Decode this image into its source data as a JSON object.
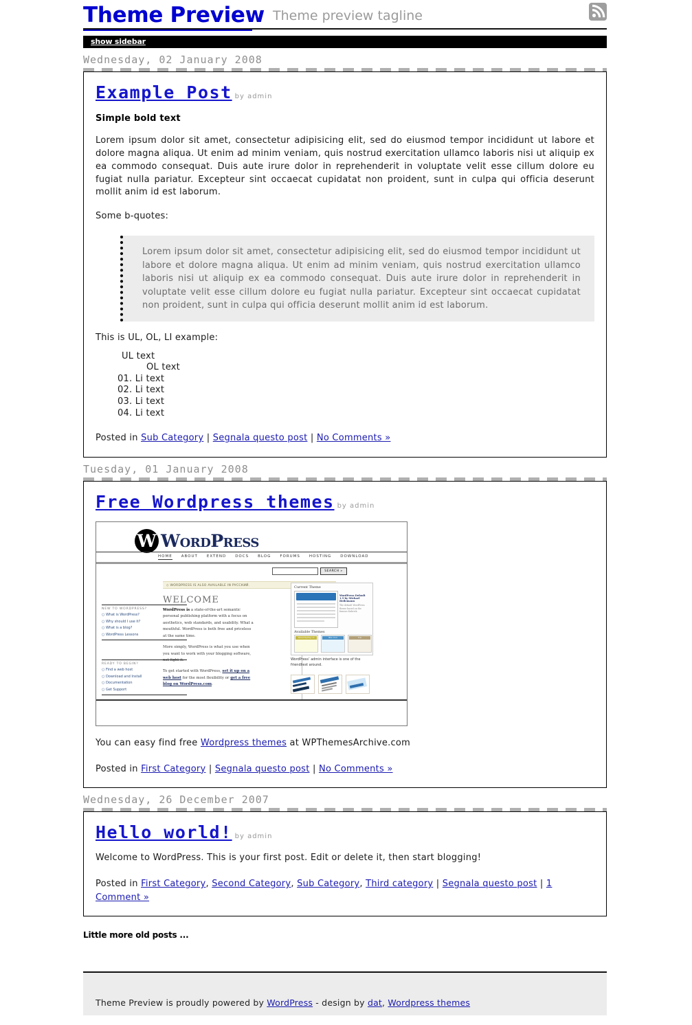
{
  "header": {
    "blog_title": "Theme Preview",
    "tagline": "Theme preview tagline",
    "rss_icon": "rss-feed-icon",
    "sidebar_toggle": "show sidebar"
  },
  "posts": [
    {
      "date": "Wednesday, 02 January 2008",
      "title": "Example Post",
      "byline": "by admin",
      "subhead": "Simple bold text",
      "body": "Lorem ipsum dolor sit amet, consectetur adipisicing elit, sed do eiusmod tempor incididunt ut labore et dolore magna aliqua. Ut enim ad minim veniam, quis nostrud exercitation ullamco laboris nisi ut aliquip ex ea commodo consequat. Duis aute irure dolor in reprehenderit in voluptate velit esse cillum dolore eu fugiat nulla pariatur. Excepteur sint occaecat cupidatat non proident, sunt in culpa qui officia deserunt mollit anim id est laborum.",
      "quote_lead": "Some b-quotes:",
      "blockquote": "Lorem ipsum dolor sit amet, consectetur adipisicing elit, sed do eiusmod tempor incididunt ut labore et dolore magna aliqua. Ut enim ad minim veniam, quis nostrud exercitation ullamco laboris nisi ut aliquip ex ea commodo consequat. Duis aute irure dolor in reprehenderit in voluptate velit esse cillum dolore eu fugiat nulla pariatur. Excepteur sint occaecat cupidatat non proident, sunt in culpa qui officia deserunt mollit anim id est laborum.",
      "list_lead": "This is UL, OL, LI example:",
      "ul_text": "UL text",
      "ol_text": "OL text",
      "li_items": [
        "01. Li text",
        "02. Li text",
        "03. Li text",
        "04. Li text"
      ],
      "meta_prefix": "Posted in ",
      "categories": [
        "Sub Category"
      ],
      "report_link": "Segnala questo post",
      "comments_link": "No Comments »",
      "sep": " | "
    },
    {
      "date": "Tuesday, 01 January 2008",
      "title": "Free Wordpress themes",
      "byline": "by admin",
      "line_before": "You can easy find free ",
      "line_link": "Wordpress themes",
      "line_after": " at WPThemesArchive.com",
      "meta_prefix": "Posted in ",
      "categories": [
        "First Category"
      ],
      "report_link": "Segnala questo post",
      "comments_link": "No Comments »",
      "sep": " | "
    },
    {
      "date": "Wednesday, 26 December 2007",
      "title": "Hello world!",
      "byline": "by admin",
      "body": "Welcome to WordPress. This is your first post. Edit or delete it, then start blogging!",
      "meta_prefix": "Posted in ",
      "categories": [
        "First Category",
        "Second Category",
        "Sub Category",
        "Third category"
      ],
      "report_link": "Segnala questo post",
      "comments_link": "1 Comment »",
      "sep": " | "
    }
  ],
  "screenshot": {
    "logo_mark": "W",
    "logo_word": "WordPress",
    "nav": [
      "HOME",
      "ABOUT",
      "EXTEND",
      "DOCS",
      "BLOG",
      "FORUMS",
      "HOSTING",
      "DOWNLOAD"
    ],
    "search_button": "SEARCH »",
    "announce": "◇ WORDPRESS IS ALSO AVAILABLE IN РУССКИЙ.",
    "welcome": "WELCOME",
    "para1_bold": "WordPress is",
    "para1": " a state-of-the-art semantic personal publishing platform with a focus on aesthetics, web standards, and usability. What a mouthful. WordPress is both free and priceless at the same time.",
    "para2": "More simply, WordPress is what you use when you want to work with your blogging software, not fight it.",
    "para3_pre": "To get started with WordPress, ",
    "para3_link1": "set it up on a web host",
    "para3_mid": " for the most flexibility or ",
    "para3_link2": "get a free blog on WordPress.com",
    "para3_end": ".",
    "block1_header": "NEW TO WORDPRESS?",
    "block1_items": [
      "○ What is WordPress?",
      "○ Why should I use it?",
      "○ What is a blog?",
      "○ WordPress Lessons"
    ],
    "block2_header": "READY TO BEGIN?",
    "block2_items": [
      "○ Find a web host",
      "○ Download and Install",
      "○ Documentation",
      "○ Get Support"
    ],
    "current_theme": "Current Theme",
    "theme_name": "WordPress Default 1.5 by Michael Heilemann",
    "theme_desc": "The default WordPress theme based on the famous Kubrick.",
    "available_themes": "Available Themes",
    "theme_thumbs": [
      "Almost Spring 1.0",
      "Blix 2.0.0",
      "Con"
    ],
    "caption": "WordPress’ admin interface is one of the friendliest around."
  },
  "old_posts": "Little more old posts ...",
  "footer": {
    "pre": "Theme Preview is proudly powered by ",
    "link1": "WordPress",
    "mid": " - design by ",
    "link2": "dat",
    "comma": ", ",
    "link3": "Wordpress themes"
  }
}
